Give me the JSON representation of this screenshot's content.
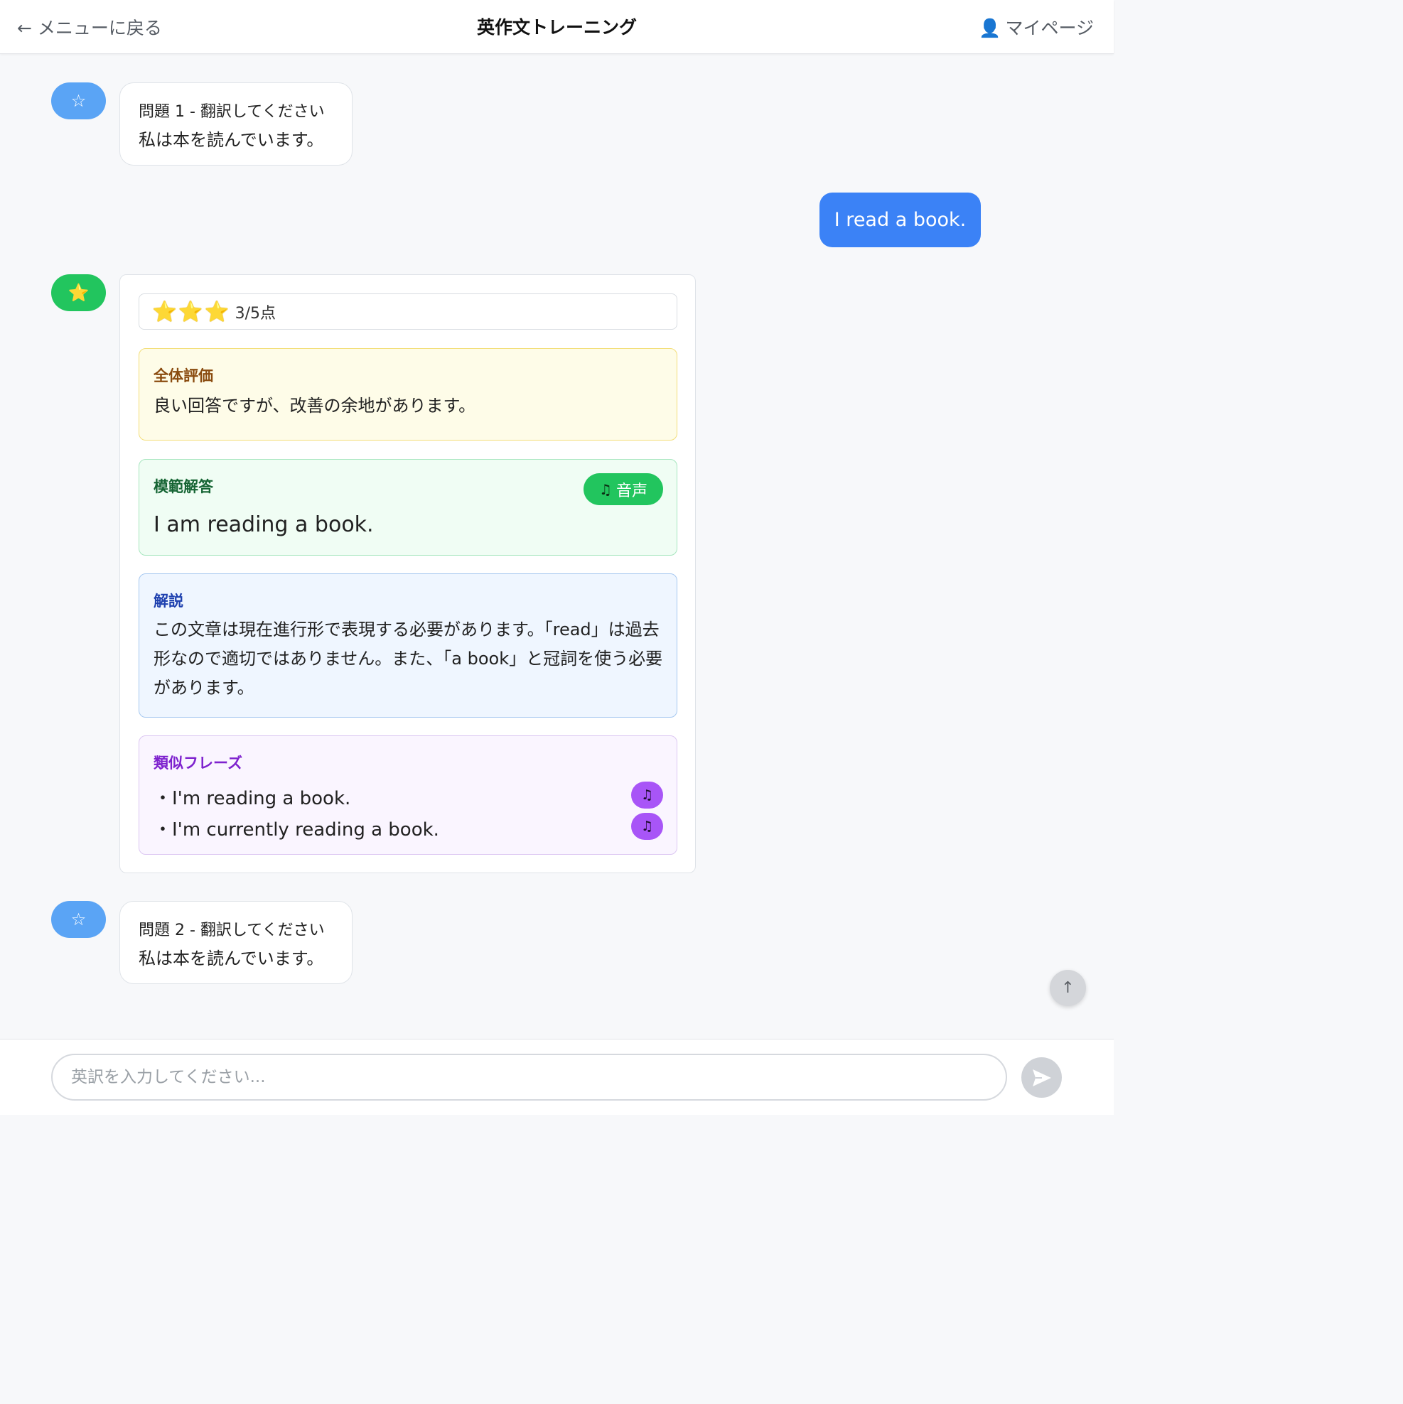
{
  "header": {
    "back_label": "← メニューに戻る",
    "title": "英作文トレーニング",
    "mypage_icon": "👤",
    "mypage_label": "マイページ"
  },
  "messages": {
    "q1": {
      "avatar_icon": "☆",
      "title": "問題 1 - 翻訳してください",
      "text": "私は本を読んでいます。"
    },
    "user_answer": "I read a book.",
    "feedback": {
      "avatar_icon": "⭐",
      "stars": "⭐⭐⭐",
      "score_text": "3/5点",
      "score": 3,
      "score_max": 5,
      "overall": {
        "label": "全体評価",
        "text": "良い回答ですが、改善の余地があります。"
      },
      "model": {
        "label": "模範解答",
        "text": "I am reading a book.",
        "audio_icon": "♫",
        "audio_label": "音声"
      },
      "explanation": {
        "label": "解説",
        "text": "この文章は現在進行形で表現する必要があります。「read」は過去形なので適切ではありません。また、「a book」と冠詞を使う必要があります。"
      },
      "similar": {
        "label": "類似フレーズ",
        "phrases": [
          "・I'm reading a book.",
          "・I'm currently reading a book."
        ],
        "audio_icon": "♫"
      }
    },
    "q2": {
      "avatar_icon": "☆",
      "title": "問題 2 - 翻訳してください",
      "text": "私は本を読んでいます。"
    }
  },
  "scroll_top_icon": "↑",
  "input": {
    "placeholder": "英訳を入力してください...",
    "value": ""
  },
  "colors": {
    "accent": "#3b82f6",
    "success": "#22c55e",
    "purple": "#a855f7"
  }
}
